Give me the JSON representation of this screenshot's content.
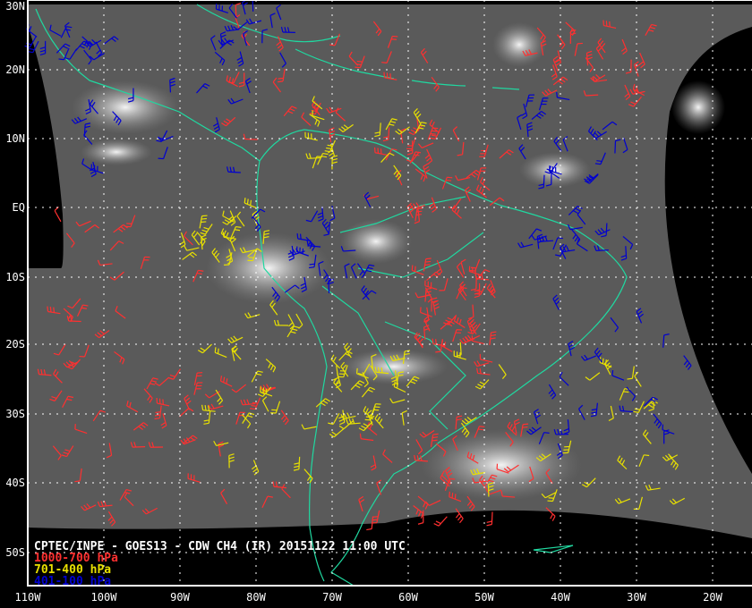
{
  "title": "CPTEC/INPE - GOES13 - CDW CH4 (IR) 20151122 11:00 UTC",
  "legend": [
    {
      "label": "1000-700 hPa",
      "color": "#ff3030"
    },
    {
      "label": "701-400 hPa",
      "color": "#e8e000"
    },
    {
      "label": "401-100 hPa",
      "color": "#0000d0"
    }
  ],
  "lat_labels": [
    "30N",
    "20N",
    "10N",
    "EQ",
    "10S",
    "20S",
    "30S",
    "40S",
    "50S"
  ],
  "lon_labels": [
    "110W",
    "100W",
    "90W",
    "80W",
    "70W",
    "60W",
    "50W",
    "40W",
    "30W",
    "20W"
  ],
  "colors": {
    "coastline": "#20d8a0",
    "grid": "#ffffff",
    "frame": "#ffffff"
  }
}
